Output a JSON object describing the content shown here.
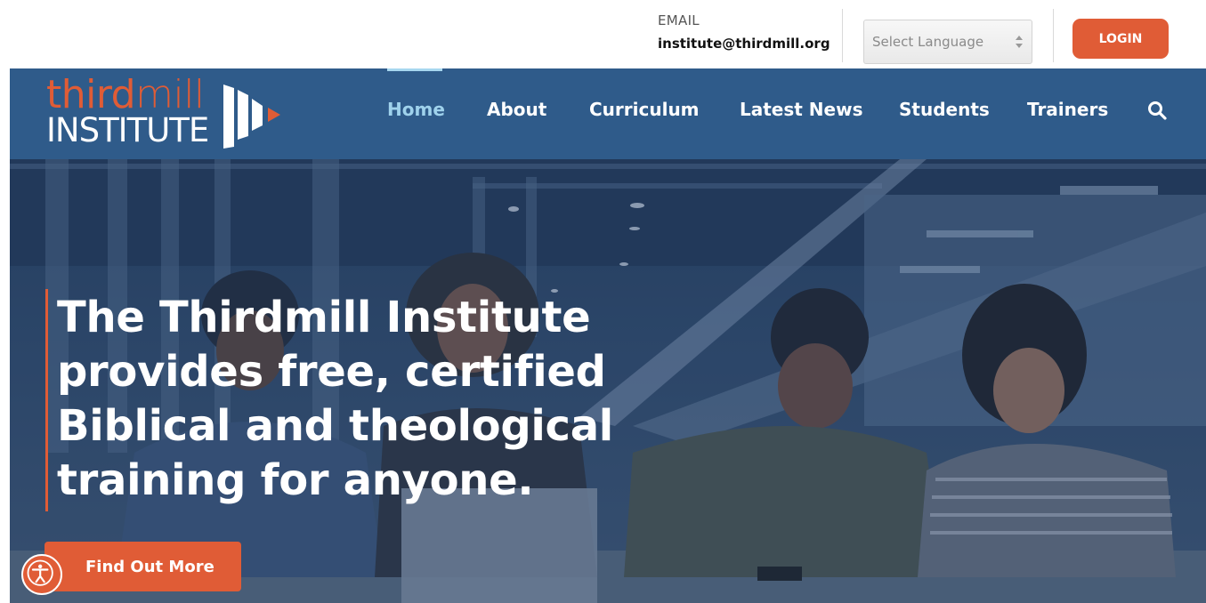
{
  "header": {
    "email_label": "EMAIL",
    "email_address": "institute@thirdmill.org",
    "language_select": {
      "selected": "Select Language"
    },
    "login_label": "LOGIN"
  },
  "logo": {
    "line1_a": "third",
    "line1_b": "mill",
    "line2": "INSTITUTE"
  },
  "nav": {
    "items": [
      {
        "label": "Home",
        "active": true
      },
      {
        "label": "About"
      },
      {
        "label": "Curriculum"
      },
      {
        "label": "Latest News"
      },
      {
        "label": "Students"
      },
      {
        "label": "Trainers"
      }
    ],
    "search_icon": "search-icon"
  },
  "hero": {
    "headline": "The Thirdmill Institute provides free, certified Biblical and theological training for anyone.",
    "cta_label": "Find Out More"
  },
  "accessibility": {
    "icon": "accessibility-icon"
  },
  "colors": {
    "accent": "#e05c36",
    "nav_bg": "#2f5b8a",
    "nav_active": "#9fd2ec"
  }
}
